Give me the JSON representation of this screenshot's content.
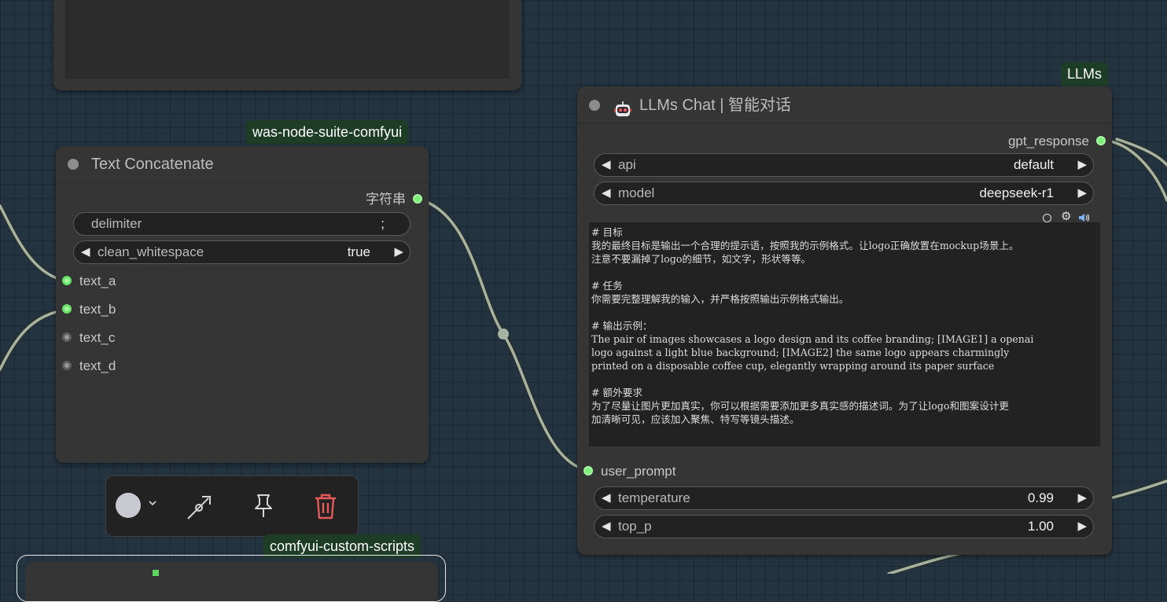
{
  "preview_node": {},
  "text_concat": {
    "badge": "was-node-suite-comfyui",
    "title": "Text Concatenate",
    "output_label": "字符串",
    "widgets": [
      {
        "name": "delimiter",
        "value": ";"
      },
      {
        "name": "clean_whitespace",
        "value": "true"
      }
    ],
    "inputs": [
      {
        "label": "text_a",
        "connected": true
      },
      {
        "label": "text_b",
        "connected": true
      },
      {
        "label": "text_c",
        "connected": false
      },
      {
        "label": "text_d",
        "connected": false
      }
    ]
  },
  "llm_node": {
    "badge": "LLMs",
    "title_icon": "robot-emoji",
    "title": "LLMs Chat | 智能对话",
    "output_label": "gpt_response",
    "widgets_top": [
      {
        "name": "api",
        "value": "default"
      },
      {
        "name": "model",
        "value": "deepseek-r1"
      }
    ],
    "prompt_lines": [
      "# 目标",
      "我的最终目标是输出一个合理的提示语，按照我的示例格式。让logo正确放置在mockup场景上。",
      "注意不要漏掉了logo的细节，如文字，形状等等。",
      "",
      "# 任务",
      "你需要完整理解我的输入，并严格按照输出示例格式输出。",
      "",
      "# 输出示例：",
      "The pair of images showcases a logo design and its coffee branding; [IMAGE1] a openai",
      "logo against a light blue background; [IMAGE2] the same logo appears charmingly",
      "printed on a disposable coffee cup, elegantly wrapping around its paper surface",
      "",
      "# 额外要求",
      "为了尽量让图片更加真实，你可以根据需要添加更多真实感的描述词。为了让logo和图案设计更",
      "加清晰可见，应该加入聚焦、特写等镜头描述。"
    ],
    "input_label": "user_prompt",
    "widgets_bottom": [
      {
        "name": "temperature",
        "value": "0.99"
      },
      {
        "name": "top_p",
        "value": "1.00"
      }
    ]
  },
  "toolbar": {
    "color_swatch": "#c9c9d2",
    "icons": [
      "color-dropdown-chevron",
      "bypass-icon",
      "pin-icon",
      "trash-icon"
    ],
    "badge": "comfyui-custom-scripts"
  },
  "colors": {
    "canvas": "#243340",
    "node_bg": "#353535",
    "link": "#a6b3a1",
    "badge_bg": "#1e3d26",
    "trash": "#e35b5b"
  }
}
